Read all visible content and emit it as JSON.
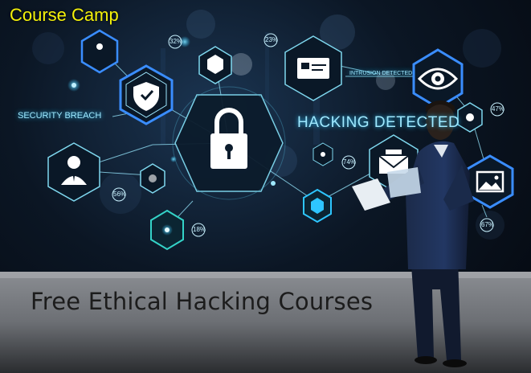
{
  "brand": {
    "name": "Course Camp",
    "color": "#f4f10a"
  },
  "overlay": {
    "security_breach": "SECURITY BREACH",
    "intrusion_detected": "INTRUSION DETECTED",
    "hacking_detected": "HACKING DETECTED",
    "percentages": [
      "32%",
      "23%",
      "47%",
      "74%",
      "56%",
      "18%",
      "67%"
    ]
  },
  "headline": {
    "text": "Free Ethical Hacking Courses"
  },
  "icons": [
    "padlock-icon",
    "shield-icon",
    "eye-icon",
    "card-icon",
    "user-icon",
    "envelope-icon",
    "image-icon",
    "gear-icon"
  ],
  "colors": {
    "accent": "#2ec6ff",
    "background": "#05080f",
    "floor": "#9a9a9a"
  }
}
